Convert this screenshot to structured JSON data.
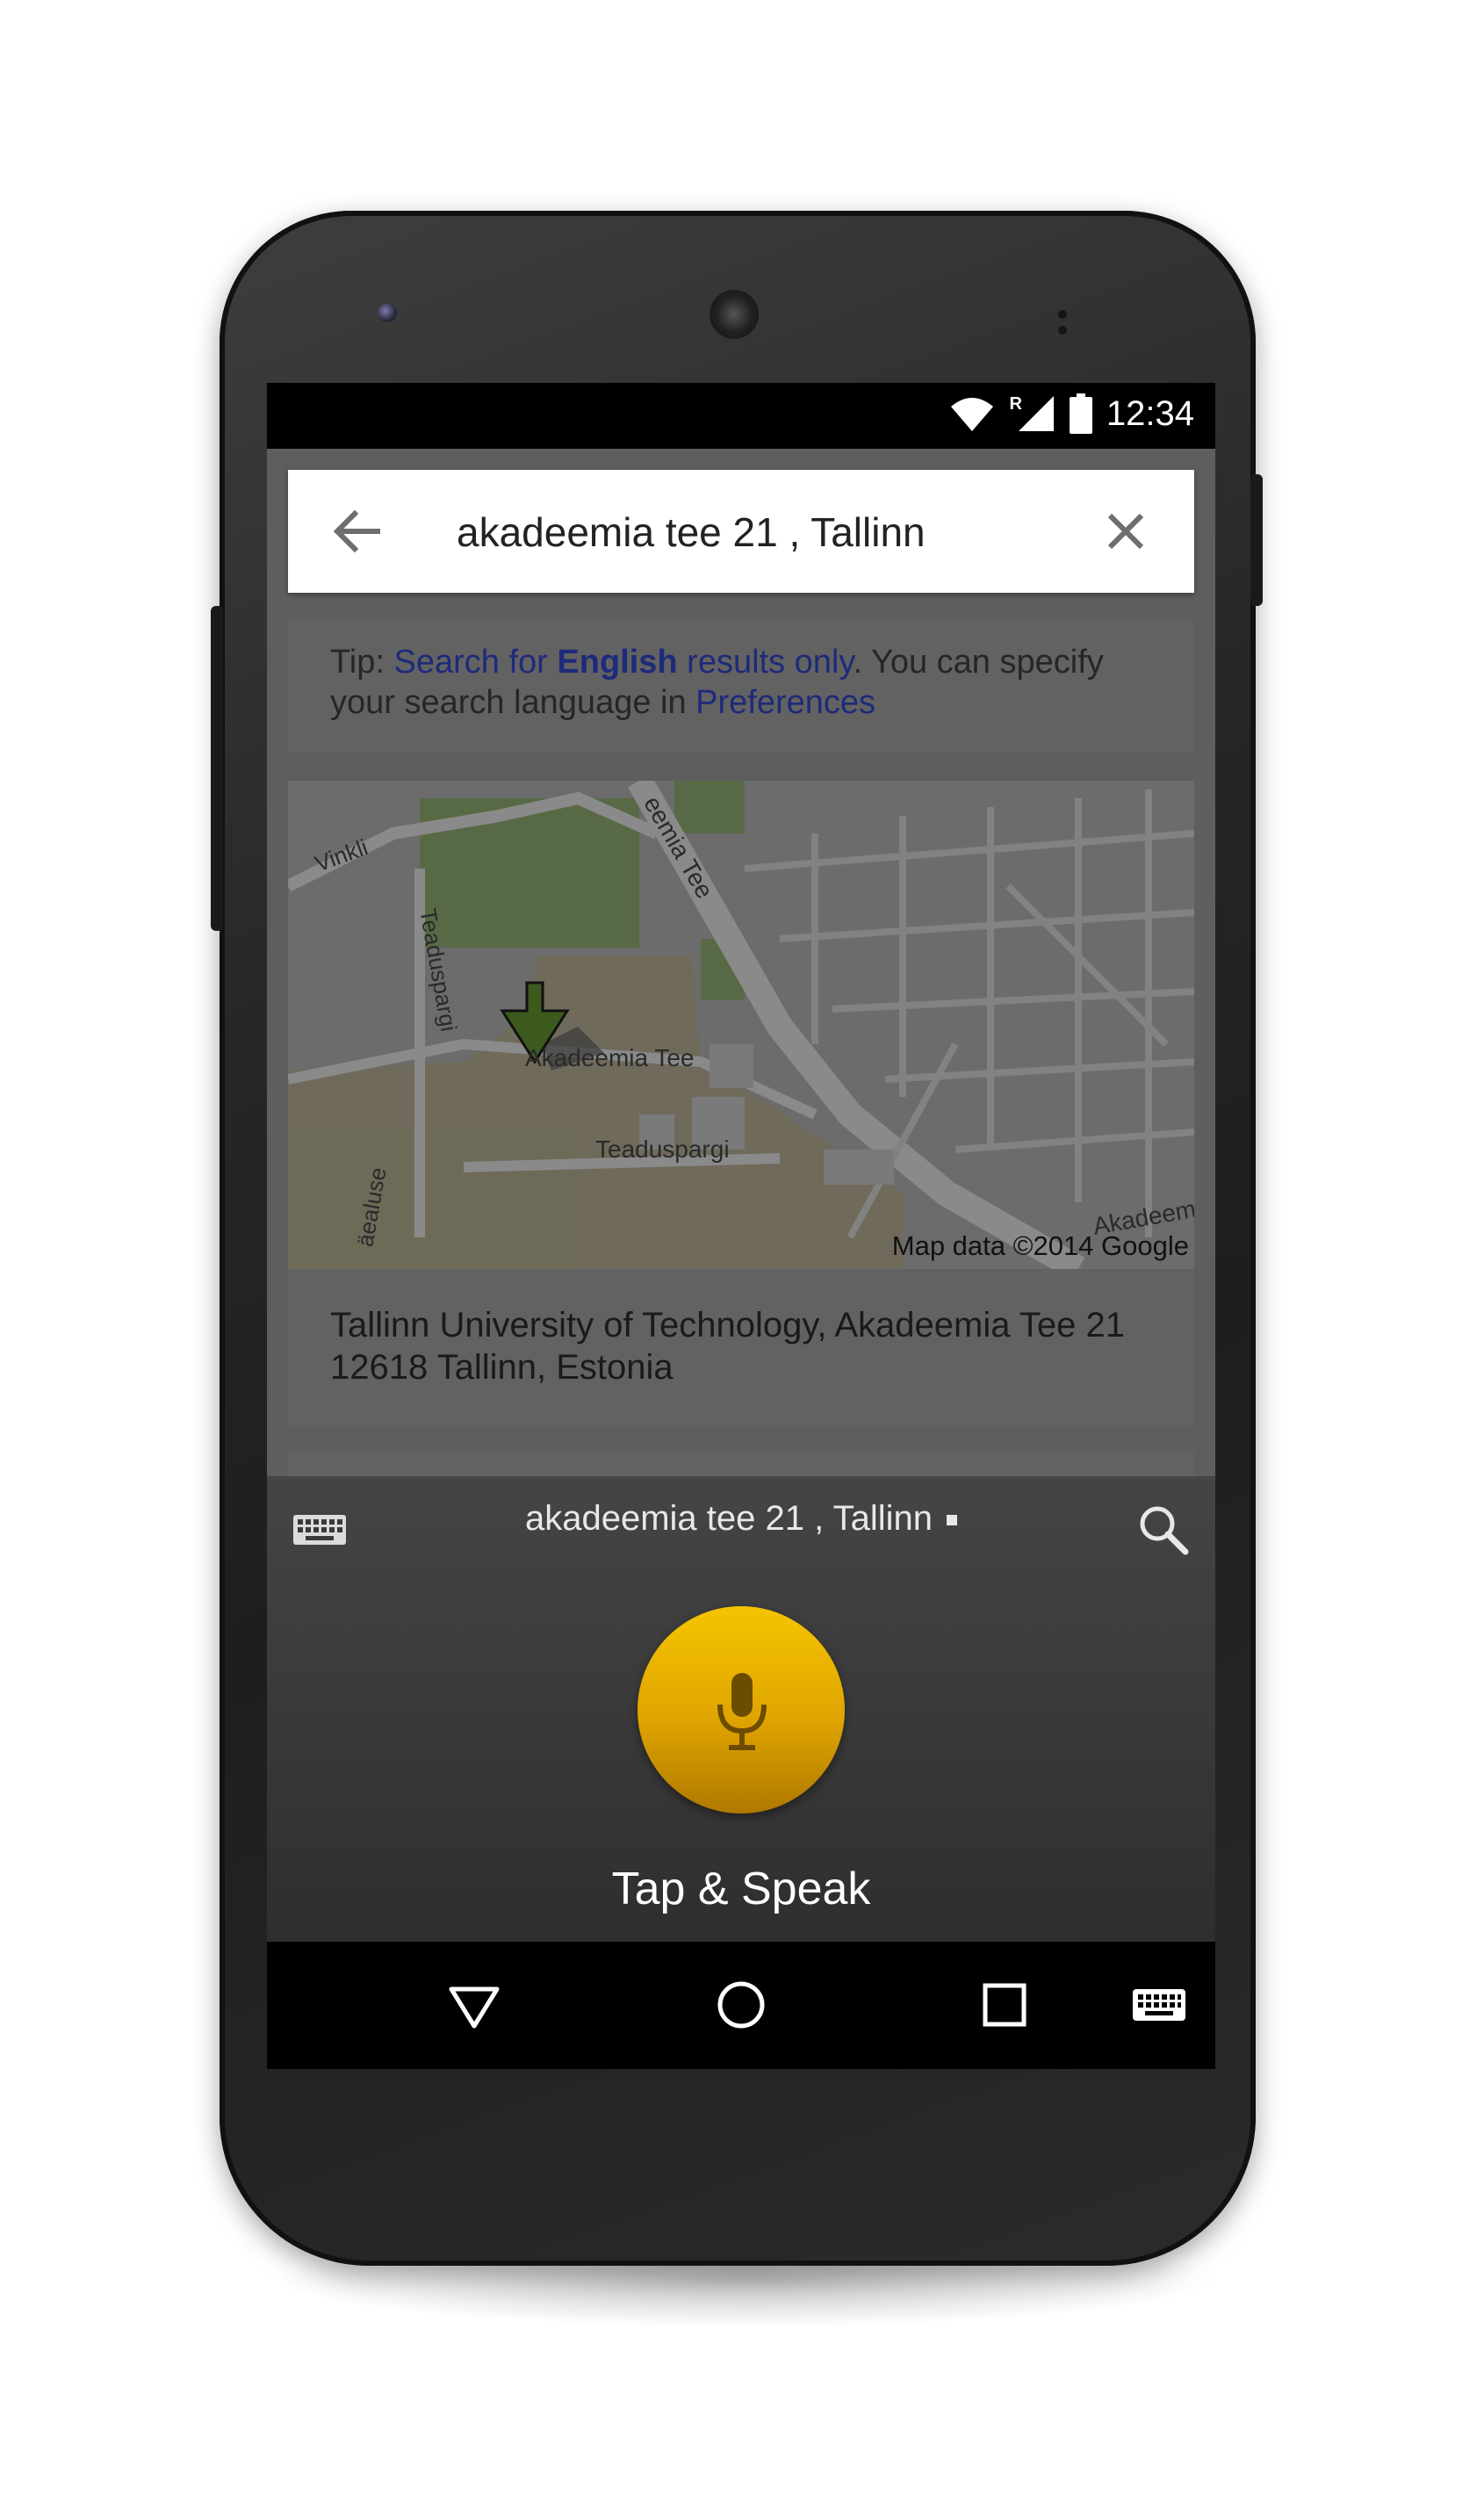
{
  "status_bar": {
    "time": "12:34",
    "roaming_label": "R",
    "icons": [
      "wifi-icon",
      "signal-icon",
      "battery-icon"
    ]
  },
  "search": {
    "query": "akadeemia tee 21 , Tallinn",
    "back_icon": "arrow-back-icon",
    "clear_icon": "close-icon"
  },
  "tip": {
    "prefix": "Tip: ",
    "link1": "Search for ",
    "link1_bold": "English",
    "link1_tail": " results only",
    "middle": ". You can specify your search language in ",
    "link2": "Preferences"
  },
  "map": {
    "labels": {
      "vinkli": "Vinkli",
      "akadeemia_tee_top": "eemia Tee",
      "teaduspargi_vertical": "Teaduspargi",
      "akadeemia_tee_mid": "Akadeemia Tee",
      "teaduspargi": "Teaduspargi",
      "vaealuse": "äealuse",
      "akadeemia_right": "Akadeemia"
    },
    "credit": "Map data ©2014 Google"
  },
  "result": {
    "address_line1": "Tallinn University of Technology, Akadeemia Tee 21",
    "address_line2": "12618 Tallinn, Estonia"
  },
  "voice": {
    "query": "akadeemia tee 21 , Tallinn",
    "button_label": "Tap & Speak",
    "keyboard_icon": "keyboard-icon",
    "search_icon": "search-icon",
    "mic_icon": "microphone-icon"
  },
  "nav": {
    "icons": [
      "back-icon",
      "home-icon",
      "recents-icon",
      "keyboard-icon"
    ]
  },
  "colors": {
    "mic_accent": "#f0b800",
    "link": "#1e2a7a"
  }
}
